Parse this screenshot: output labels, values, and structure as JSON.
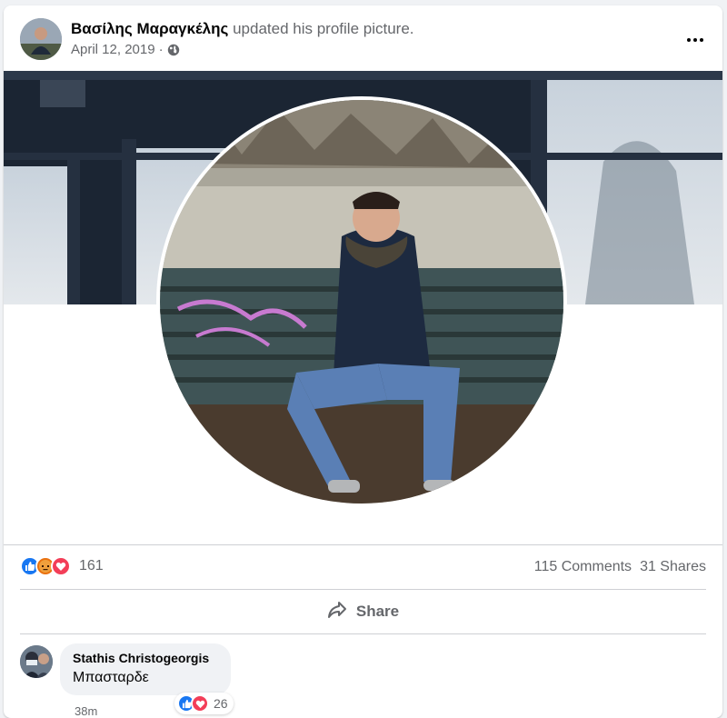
{
  "post": {
    "author": "Βασίλης Μαραγκέλης",
    "action": "updated his profile picture.",
    "date": "April 12, 2019",
    "separator": "·",
    "privacy_icon": "globe-icon",
    "more_icon": "more-options-icon"
  },
  "stats": {
    "reactions": [
      "like",
      "angry",
      "love"
    ],
    "reaction_count": "161",
    "comments": "115 Comments",
    "shares": "31 Shares"
  },
  "actions": {
    "share_label": "Share",
    "share_icon": "share-arrow-icon"
  },
  "comment": {
    "author": "Stathis Christogeorgis",
    "text": "Μπασταρδε",
    "time": "38m",
    "reactions": [
      "like",
      "love"
    ],
    "reaction_count": "26"
  },
  "colors": {
    "like": "#1877f2",
    "love": "#f33e58",
    "angry": "#e9710f",
    "secondary_text": "#65676b"
  }
}
